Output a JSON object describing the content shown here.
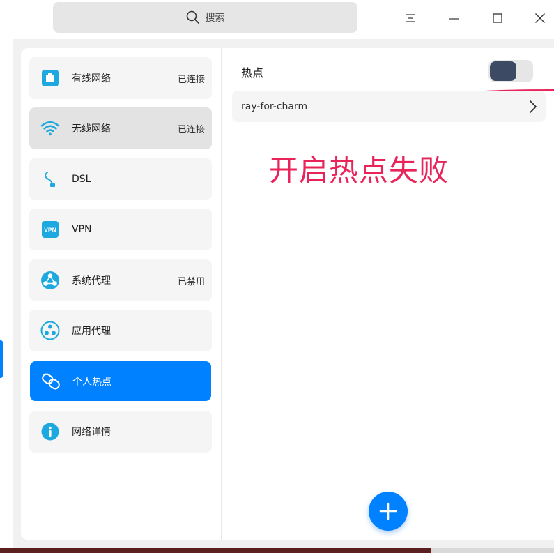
{
  "search": {
    "label": "搜索"
  },
  "window_controls": [
    "menu-icon",
    "minimize-icon",
    "maximize-icon",
    "close-icon"
  ],
  "nav": {
    "items": [
      {
        "label": "有线网络",
        "status": "已连接",
        "icon": "wired-network-icon"
      },
      {
        "label": "无线网络",
        "status": "已连接",
        "icon": "wifi-icon"
      },
      {
        "label": "DSL",
        "status": "",
        "icon": "dsl-icon"
      },
      {
        "label": "VPN",
        "status": "",
        "icon": "vpn-icon",
        "icon_text": "VPN"
      },
      {
        "label": "系统代理",
        "status": "已禁用",
        "icon": "system-proxy-icon"
      },
      {
        "label": "应用代理",
        "status": "",
        "icon": "app-proxy-icon"
      },
      {
        "label": "个人热点",
        "status": "",
        "icon": "hotspot-icon",
        "active": true
      },
      {
        "label": "网络详情",
        "status": "",
        "icon": "info-icon"
      }
    ]
  },
  "hotspot": {
    "title": "热点",
    "toggle_on": false,
    "ssid": "ray-for-charm"
  },
  "annotation": "开启热点失败",
  "colors": {
    "accent": "#0081ff",
    "annotation": "#e8245a",
    "toggle_knob": "#3d4a63",
    "icon_teal": "#1da9e0"
  }
}
